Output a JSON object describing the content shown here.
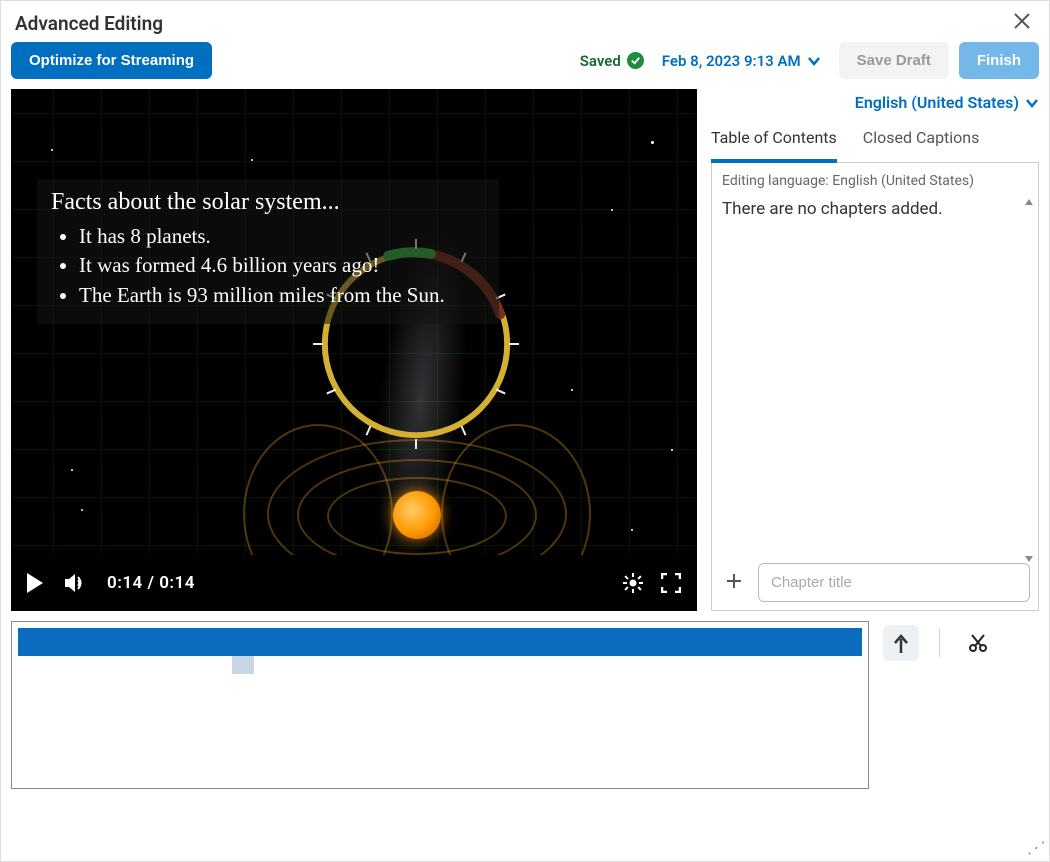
{
  "header": {
    "title": "Advanced Editing"
  },
  "toolbar": {
    "optimize_label": "Optimize for Streaming",
    "saved_label": "Saved",
    "date_label": "Feb 8, 2023 9:13 AM",
    "save_draft_label": "Save Draft",
    "finish_label": "Finish"
  },
  "video": {
    "caption_title": "Facts about the solar system...",
    "bullets": [
      "It has 8 planets.",
      "It was formed 4.6 billion years ago!",
      "The Earth is 93 million miles from the Sun."
    ],
    "time_current": "0:14",
    "time_total": "0:14"
  },
  "sidebar": {
    "lang_label": "English (United States)",
    "tabs": {
      "toc": "Table of Contents",
      "cc": "Closed Captions"
    },
    "editing_lang_note": "Editing language: English (United States)",
    "empty_msg": "There are no chapters added.",
    "chapter_placeholder": "Chapter title"
  },
  "icons": {
    "play": "play-icon",
    "volume": "volume-icon",
    "gear": "settings-icon",
    "fullscreen": "fullscreen-icon",
    "plus": "plus-icon",
    "seek": "seek-icon",
    "cut": "cut-icon"
  }
}
